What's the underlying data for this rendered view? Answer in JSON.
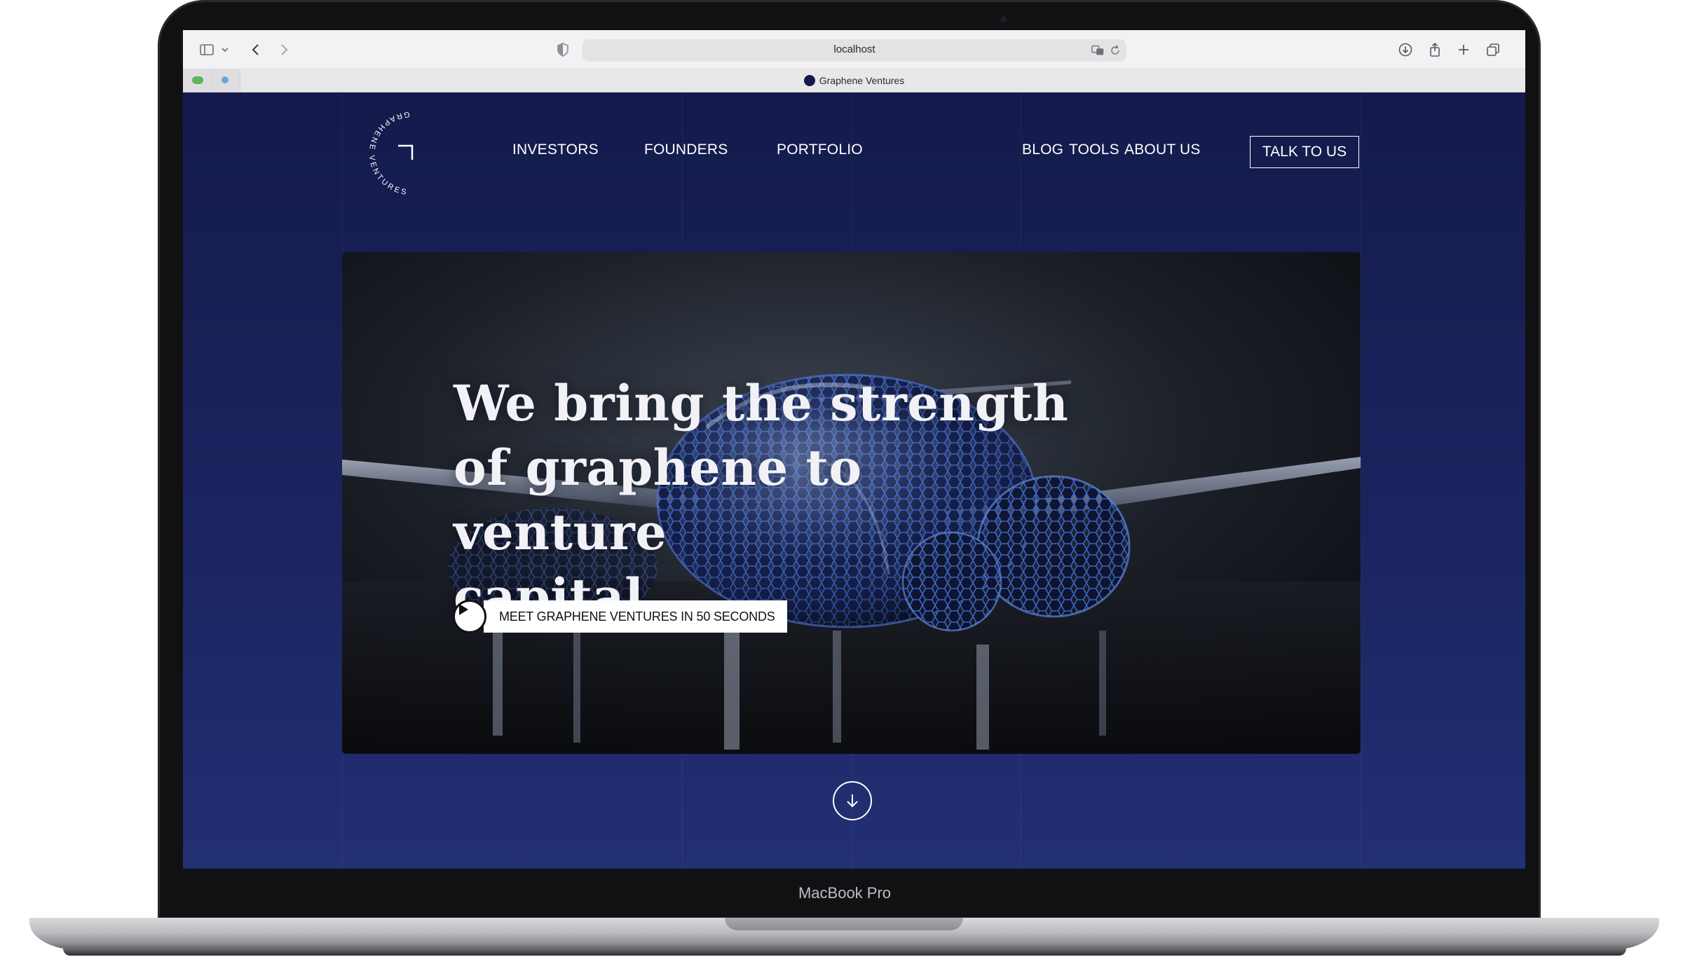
{
  "device": {
    "model_label": "MacBook Pro"
  },
  "browser": {
    "address": "localhost",
    "tab_title": "Graphene Ventures",
    "icons": [
      "sidebar-icon",
      "chevron-down-icon",
      "back-icon",
      "forward-icon",
      "shield-icon",
      "translate-icon",
      "reload-icon",
      "download-icon",
      "share-icon",
      "new-tab-icon",
      "tab-overview-icon"
    ]
  },
  "site": {
    "logo_text": "GRAPHENE VENTURES",
    "nav_left": [
      "INVESTORS",
      "FOUNDERS",
      "PORTFOLIO"
    ],
    "nav_right": [
      "BLOG",
      "TOOLS",
      "ABOUT US"
    ],
    "cta": "TALK TO US",
    "hero": {
      "title_lines": [
        "We bring the strength",
        "of graphene to venture",
        "capital"
      ],
      "video_button": "MEET GRAPHENE VENTURES IN 50 SECONDS"
    },
    "scroll_icon": "arrow-down-icon",
    "colors": {
      "background": "#1b2561",
      "text": "#ffffff",
      "accent": "#3a6ad8"
    }
  }
}
